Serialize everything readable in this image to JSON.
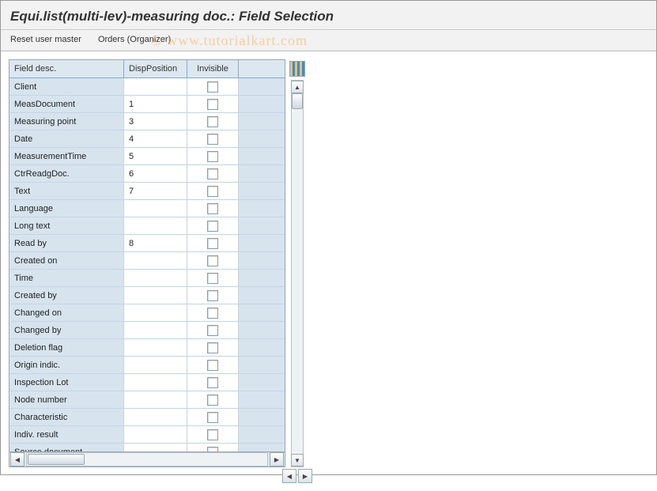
{
  "header": {
    "title": "Equi.list(multi-lev)-measuring doc.: Field Selection"
  },
  "toolbar": {
    "reset_label": "Reset user master",
    "orders_label": "Orders (Organizer)"
  },
  "watermark": "© www.tutorialkart.com",
  "table": {
    "columns": {
      "desc": "Field desc.",
      "pos": "DispPosition",
      "inv": "Invisible"
    },
    "rows": [
      {
        "desc": "Client",
        "pos": "",
        "inv": false
      },
      {
        "desc": "MeasDocument",
        "pos": "1",
        "inv": false
      },
      {
        "desc": "Measuring point",
        "pos": "3",
        "inv": false
      },
      {
        "desc": "Date",
        "pos": "4",
        "inv": false
      },
      {
        "desc": "MeasurementTime",
        "pos": "5",
        "inv": false
      },
      {
        "desc": "CtrReadgDoc.",
        "pos": "6",
        "inv": false
      },
      {
        "desc": "Text",
        "pos": "7",
        "inv": false
      },
      {
        "desc": "Language",
        "pos": "",
        "inv": false
      },
      {
        "desc": "Long text",
        "pos": "",
        "inv": false
      },
      {
        "desc": "Read by",
        "pos": "8",
        "inv": false
      },
      {
        "desc": "Created on",
        "pos": "",
        "inv": false
      },
      {
        "desc": "Time",
        "pos": "",
        "inv": false
      },
      {
        "desc": "Created by",
        "pos": "",
        "inv": false
      },
      {
        "desc": "Changed on",
        "pos": "",
        "inv": false
      },
      {
        "desc": "Changed by",
        "pos": "",
        "inv": false
      },
      {
        "desc": "Deletion flag",
        "pos": "",
        "inv": false
      },
      {
        "desc": "Origin indic.",
        "pos": "",
        "inv": false
      },
      {
        "desc": "Inspection Lot",
        "pos": "",
        "inv": false
      },
      {
        "desc": "Node number",
        "pos": "",
        "inv": false
      },
      {
        "desc": "Characteristic",
        "pos": "",
        "inv": false
      },
      {
        "desc": "Indiv. result",
        "pos": "",
        "inv": false
      },
      {
        "desc": "Source document",
        "pos": "",
        "inv": false
      }
    ]
  }
}
